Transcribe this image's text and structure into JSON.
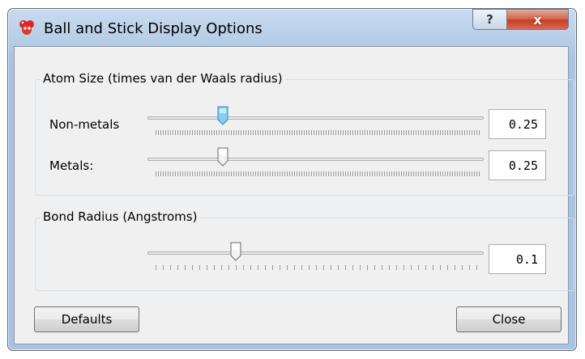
{
  "window": {
    "title": "Ball and Stick Display Options",
    "help_label": "?",
    "close_label": "x"
  },
  "atom_size": {
    "group_title": "Atom Size (times van der Waals radius)",
    "nonmetals": {
      "label": "Non-metals",
      "value": "0.25",
      "position": 0.2,
      "focused": true
    },
    "metals": {
      "label": "Metals:",
      "value": "0.25",
      "position": 0.2,
      "focused": false
    }
  },
  "bond_radius": {
    "group_title": "Bond Radius (Angstroms)",
    "slider": {
      "value": "0.1",
      "position": 0.26
    }
  },
  "buttons": {
    "defaults": "Defaults",
    "close": "Close"
  },
  "icons": {
    "app": "molecule-icon"
  },
  "colors": {
    "focus_thumb": "#56b4ea",
    "close_button": "#c9452a"
  }
}
